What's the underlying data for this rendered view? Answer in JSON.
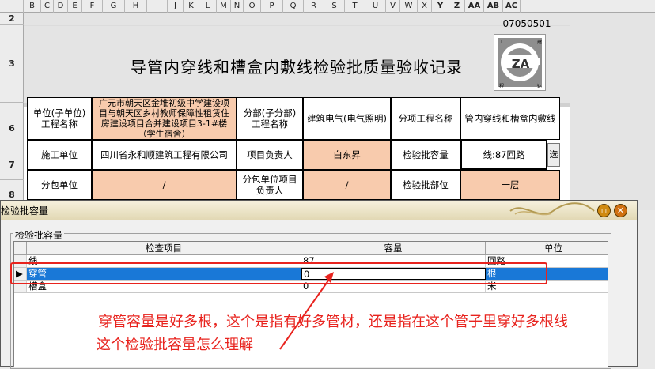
{
  "sheet": {
    "columns": [
      {
        "label": "B",
        "w": 22
      },
      {
        "label": "C",
        "w": 16
      },
      {
        "label": "D",
        "w": 18
      },
      {
        "label": "E",
        "w": 18
      },
      {
        "label": "F",
        "w": 26
      },
      {
        "label": "G",
        "w": 28
      },
      {
        "label": "H",
        "w": 28
      },
      {
        "label": "I",
        "w": 26
      },
      {
        "label": "J",
        "w": 20
      },
      {
        "label": "K",
        "w": 20
      },
      {
        "label": "L",
        "w": 22
      },
      {
        "label": "M",
        "w": 18
      },
      {
        "label": "N",
        "w": 16
      },
      {
        "label": "O",
        "w": 22
      },
      {
        "label": "P",
        "w": 28
      },
      {
        "label": "Q",
        "w": 26
      },
      {
        "label": "R",
        "w": 26
      },
      {
        "label": "S",
        "w": 26
      },
      {
        "label": "T",
        "w": 26
      },
      {
        "label": "U",
        "w": 26
      },
      {
        "label": "V",
        "w": 18
      },
      {
        "label": "W",
        "w": 22
      },
      {
        "label": "X",
        "w": 18
      },
      {
        "label": "Y",
        "w": 22
      },
      {
        "label": "Z",
        "w": 20
      },
      {
        "label": "AA",
        "w": 24
      },
      {
        "label": "AB",
        "w": 24
      },
      {
        "label": "AC",
        "w": 22
      }
    ],
    "rows": [
      "2",
      "3",
      "6",
      "7",
      "8"
    ],
    "record_code": "07050501",
    "logo_letters": "ZA",
    "logo_corners": [
      "工",
      "建",
      "程",
      "达"
    ],
    "title": "导管内穿线和槽盒内敷线检验批质量验收记录",
    "row6": {
      "unit_label": "单位(子单位)工程名称",
      "unit_value": "广元市朝天区金堆初级中学建设项目与朝天区乡村教师保障性租赁住房建设项目合并建设项目3-1#楼（学生宿舍）",
      "subdivision_label": "分部(子分部)工程名称",
      "subdivision_value": "建筑电气(电气照明)",
      "subitem_label": "分项工程名称",
      "subitem_value": "管内穿线和槽盒内敷线"
    },
    "row7": {
      "contractor_label": "施工单位",
      "contractor_value": "四川省永和顺建筑工程有限公司",
      "pm_label": "项目负责人",
      "pm_value": "白东昇",
      "capacity_label": "检验批容量",
      "capacity_value": "线:87回路",
      "select_label": "选"
    },
    "row8": {
      "sub_label": "分包单位",
      "sub_value": "/",
      "sub_pm_label": "分包单位项目负责人",
      "sub_pm_value": "/",
      "part_label": "检验批部位",
      "part_value": "一层"
    }
  },
  "dialog": {
    "title": "检验批容量",
    "group_label": "检验批容量",
    "headers": [
      "检查项目",
      "容量",
      "单位"
    ],
    "rows": [
      {
        "item": "线",
        "capacity": "87",
        "unit": "回路",
        "selected": false
      },
      {
        "item": "穿管",
        "capacity": "0",
        "unit": "根",
        "selected": true
      },
      {
        "item": "槽盒",
        "capacity": "0",
        "unit": "米",
        "selected": false
      }
    ],
    "minimize_icon": "minimize-icon",
    "close_icon": "close-icon"
  },
  "annotation": {
    "line1": "穿管容量是好多根，这个是指有好多管材，还是指在这个管子里穿好多根线",
    "line2": "这个检验批容量怎么理解",
    "color": "#e8231e"
  }
}
